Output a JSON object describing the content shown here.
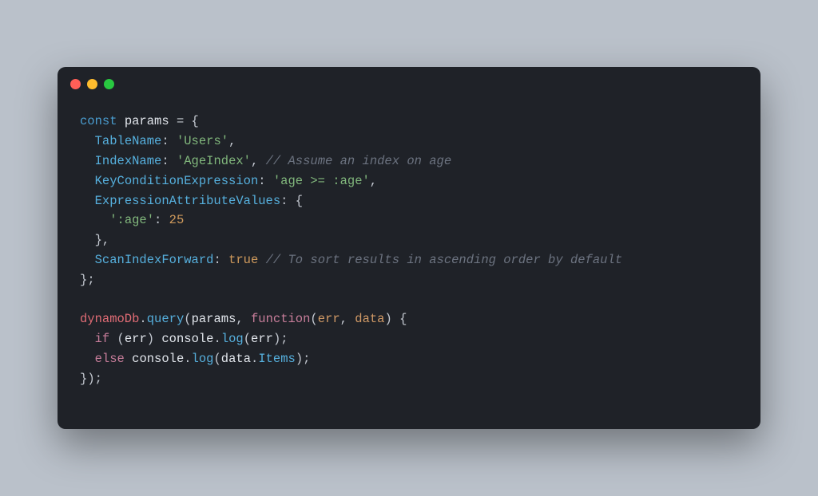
{
  "window": {
    "dots": [
      "red",
      "yellow",
      "green"
    ]
  },
  "code": {
    "t_const": "const",
    "t_params": "params",
    "t_eq": " = ",
    "t_lbrace": "{",
    "t_rbrace": "}",
    "t_lparen": "(",
    "t_rparen": ")",
    "t_semi": ";",
    "t_colon": ":",
    "t_comma": ",",
    "indent1": "  ",
    "indent2": "    ",
    "TableName": "TableName",
    "TableName_val": "'Users'",
    "IndexName": "IndexName",
    "IndexName_val": "'AgeIndex'",
    "IndexName_comment": "// Assume an index on age",
    "KeyConditionExpression": "KeyConditionExpression",
    "KeyConditionExpression_val": "'age >= :age'",
    "ExpressionAttributeValues": "ExpressionAttributeValues",
    "ageKey": "':age'",
    "ageVal": "25",
    "ScanIndexForward": "ScanIndexForward",
    "ScanIndexForward_val": "true",
    "ScanIndexForward_comment": "// To sort results in ascending order by default",
    "dynamoDb": "dynamoDb",
    "dot": ".",
    "query": "query",
    "function": "function",
    "err": "err",
    "data": "data",
    "if": "if",
    "else": "else",
    "console": "console",
    "log": "log",
    "Items": "Items",
    "space": " "
  }
}
